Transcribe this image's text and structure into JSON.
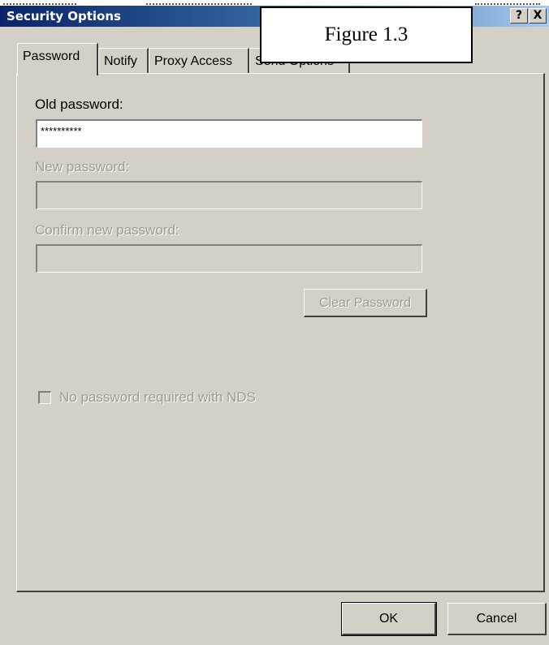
{
  "window": {
    "title": "Security Options",
    "help_button": "?",
    "close_button": "X"
  },
  "figure_label": "Figure 1.3",
  "tabs": [
    {
      "label": "Password",
      "active": true
    },
    {
      "label": "Notify",
      "active": false
    },
    {
      "label": "Proxy Access",
      "active": false
    },
    {
      "label": "Send Options",
      "active": false
    }
  ],
  "form": {
    "old_password_label": "Old password:",
    "old_password_value": "**********",
    "new_password_label": "New password:",
    "new_password_value": "",
    "confirm_password_label": "Confirm new password:",
    "confirm_password_value": "",
    "clear_password_button": "Clear Password",
    "nds_checkbox_label": "No password required with NDS",
    "nds_checkbox_checked": false
  },
  "footer": {
    "ok_button": "OK",
    "cancel_button": "Cancel"
  },
  "colors": {
    "title_gradient_start": "#0a246a",
    "title_gradient_end": "#a6caf0",
    "dialog_face": "#d4d0c8",
    "disabled_text": "#9c9a94"
  }
}
